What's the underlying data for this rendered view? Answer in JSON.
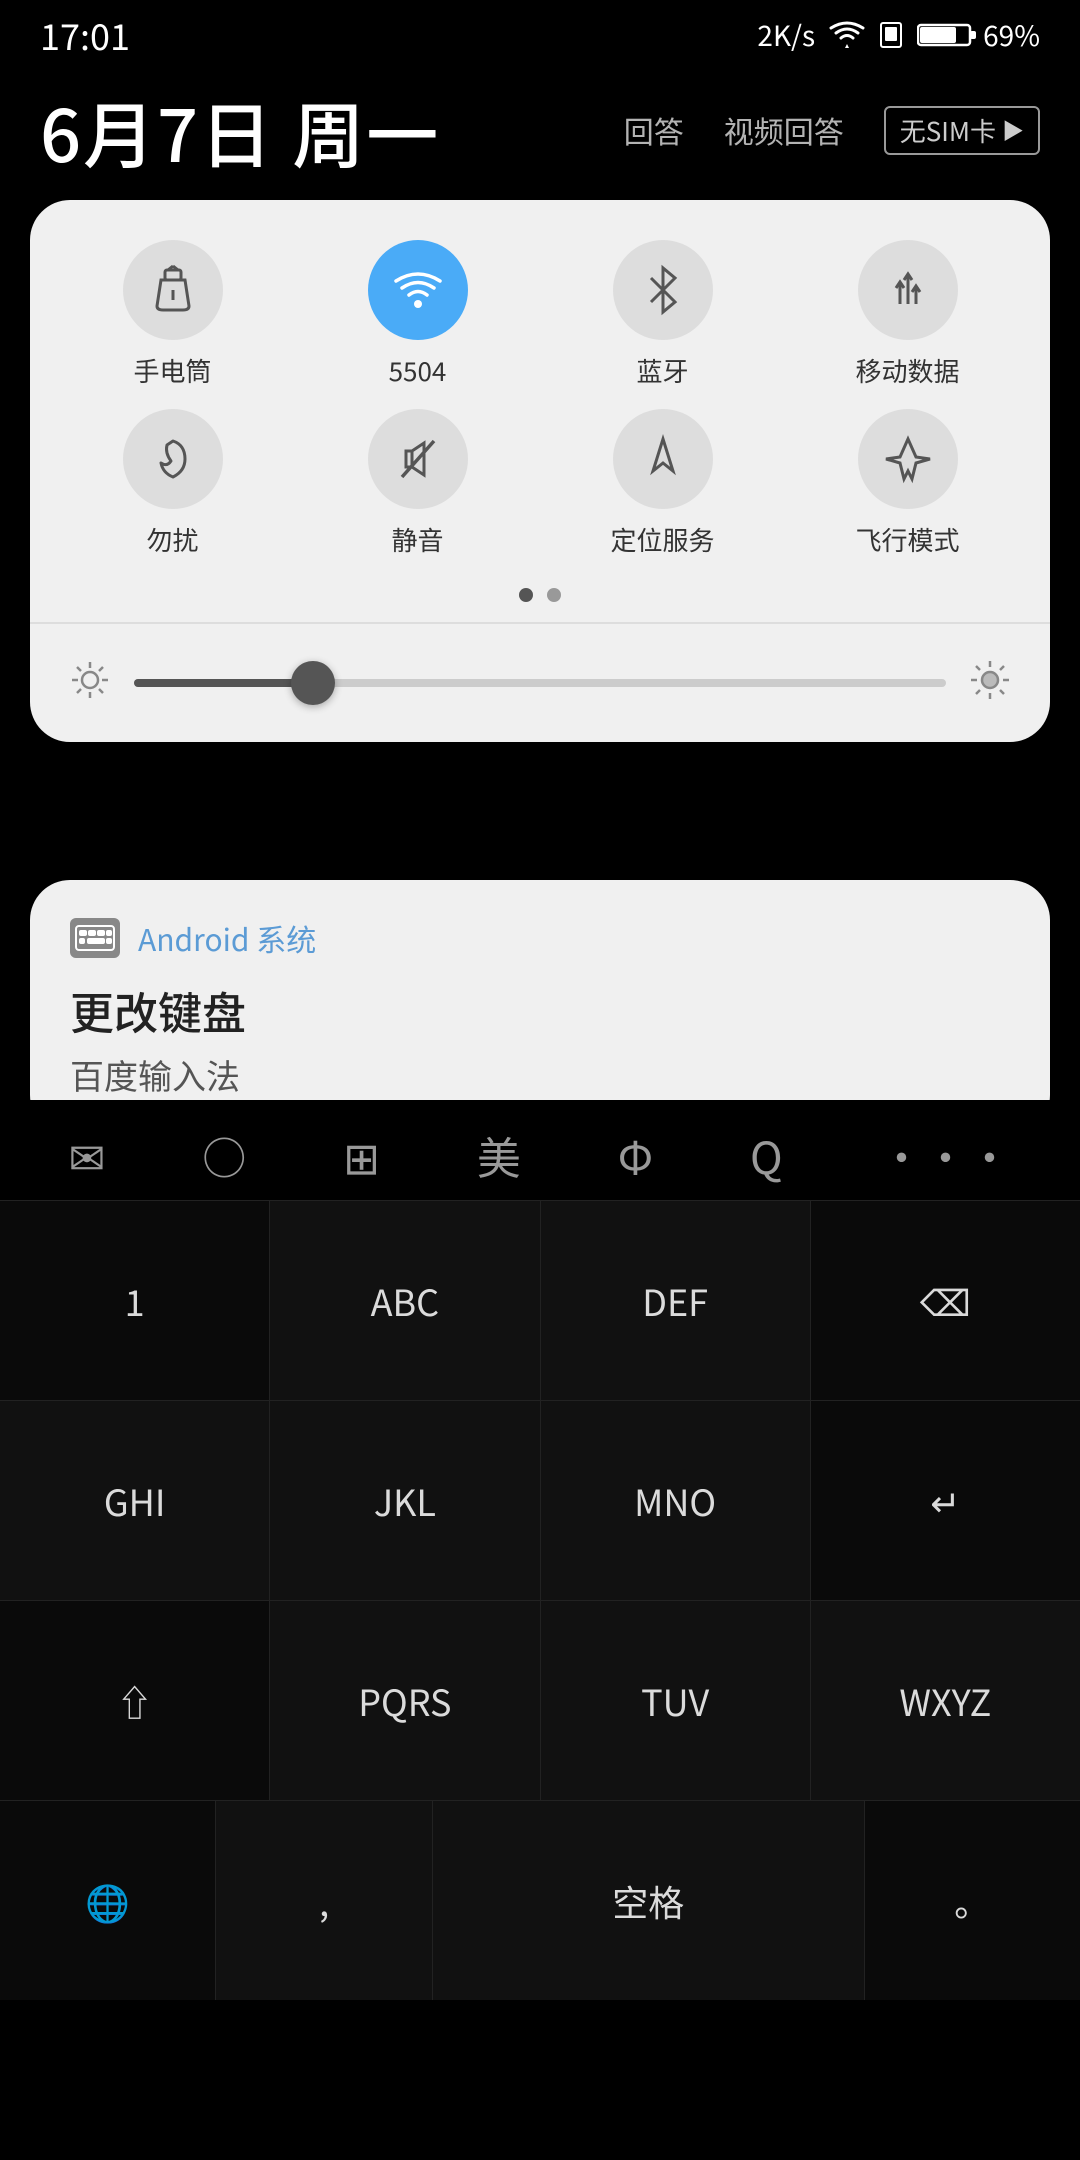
{
  "status_bar": {
    "time": "17:01",
    "network_speed": "2K/s",
    "battery_pct": "69%"
  },
  "date_area": {
    "date": "6月7日 周一",
    "menu_item1": "回答",
    "menu_item2": "视频回答",
    "sim_label": "无SIM卡"
  },
  "quick_settings": {
    "items": [
      {
        "id": "flashlight",
        "label": "手电筒",
        "active": false
      },
      {
        "id": "wifi",
        "label": "5504",
        "active": true
      },
      {
        "id": "bluetooth",
        "label": "蓝牙",
        "active": false
      },
      {
        "id": "mobile_data",
        "label": "移动数据",
        "active": false
      },
      {
        "id": "dnd",
        "label": "勿扰",
        "active": false
      },
      {
        "id": "silent",
        "label": "静音",
        "active": false
      },
      {
        "id": "location",
        "label": "定位服务",
        "active": false
      },
      {
        "id": "airplane",
        "label": "飞行模式",
        "active": false
      }
    ],
    "brightness_pct": 22
  },
  "notification": {
    "app_name": "Android 系统",
    "title": "更改键盘",
    "body": "百度输入法"
  },
  "keyboard": {
    "top_icons": [
      "✉",
      "○",
      "⊞",
      "美",
      "Φ",
      "Q",
      "⋯"
    ],
    "rows": [
      [
        {
          "main": "1",
          "sub": ""
        },
        {
          "main": "ABC",
          "sub": ""
        },
        {
          "main": "DEF",
          "sub": ""
        },
        {
          "main": "⌫",
          "sub": ""
        }
      ],
      [
        {
          "main": "GHI",
          "sub": ""
        },
        {
          "main": "JKL",
          "sub": ""
        },
        {
          "main": "MNO",
          "sub": ""
        },
        {
          "main": "↵",
          "sub": ""
        }
      ],
      [
        {
          "main": "PQRS",
          "sub": ""
        },
        {
          "main": "TUV",
          "sub": ""
        },
        {
          "main": "WXYZ",
          "sub": ""
        },
        {
          "main": "",
          "sub": ""
        }
      ],
      [
        {
          "main": "",
          "sub": ""
        },
        {
          "main": "",
          "sub": ""
        },
        {
          "main": "",
          "sub": ""
        },
        {
          "main": "",
          "sub": ""
        }
      ]
    ]
  }
}
